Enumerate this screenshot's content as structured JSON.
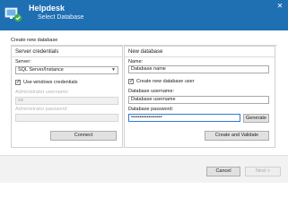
{
  "window": {
    "app_name": "Helpdesk",
    "subtitle": "Select Database",
    "close_glyph": "✕"
  },
  "section": {
    "title": "Create new database"
  },
  "server": {
    "title": "Server credentials",
    "server_label": "Server:",
    "server_value": "SQL Server/Instance",
    "windows_cred_label": "Use windows credentials",
    "windows_cred_checked": true,
    "admin_user_label": "Administrator username:",
    "admin_user_value": "sa",
    "admin_pass_label": "Administrator password:",
    "admin_pass_value": "",
    "connect_label": "Connect"
  },
  "database": {
    "title": "New database",
    "name_label": "Name:",
    "name_value": "Database name",
    "create_user_label": "Create new database user",
    "create_user_checked": true,
    "username_label": "Database username:",
    "username_value": "Database username",
    "password_label": "Database password:",
    "password_value": "••••••••••••••••••",
    "generate_label": "Generate",
    "create_validate_label": "Create and Validate"
  },
  "footer": {
    "cancel_label": "Cancel",
    "next_label": "Next >"
  },
  "colors": {
    "titlebar": "#1f6fb3",
    "focus_border": "#2f7bd6"
  },
  "icons": {
    "app": "helpdesk-logo-icon",
    "close": "close-icon",
    "dropdown": "chevron-down-icon",
    "check": "checkmark-icon"
  }
}
